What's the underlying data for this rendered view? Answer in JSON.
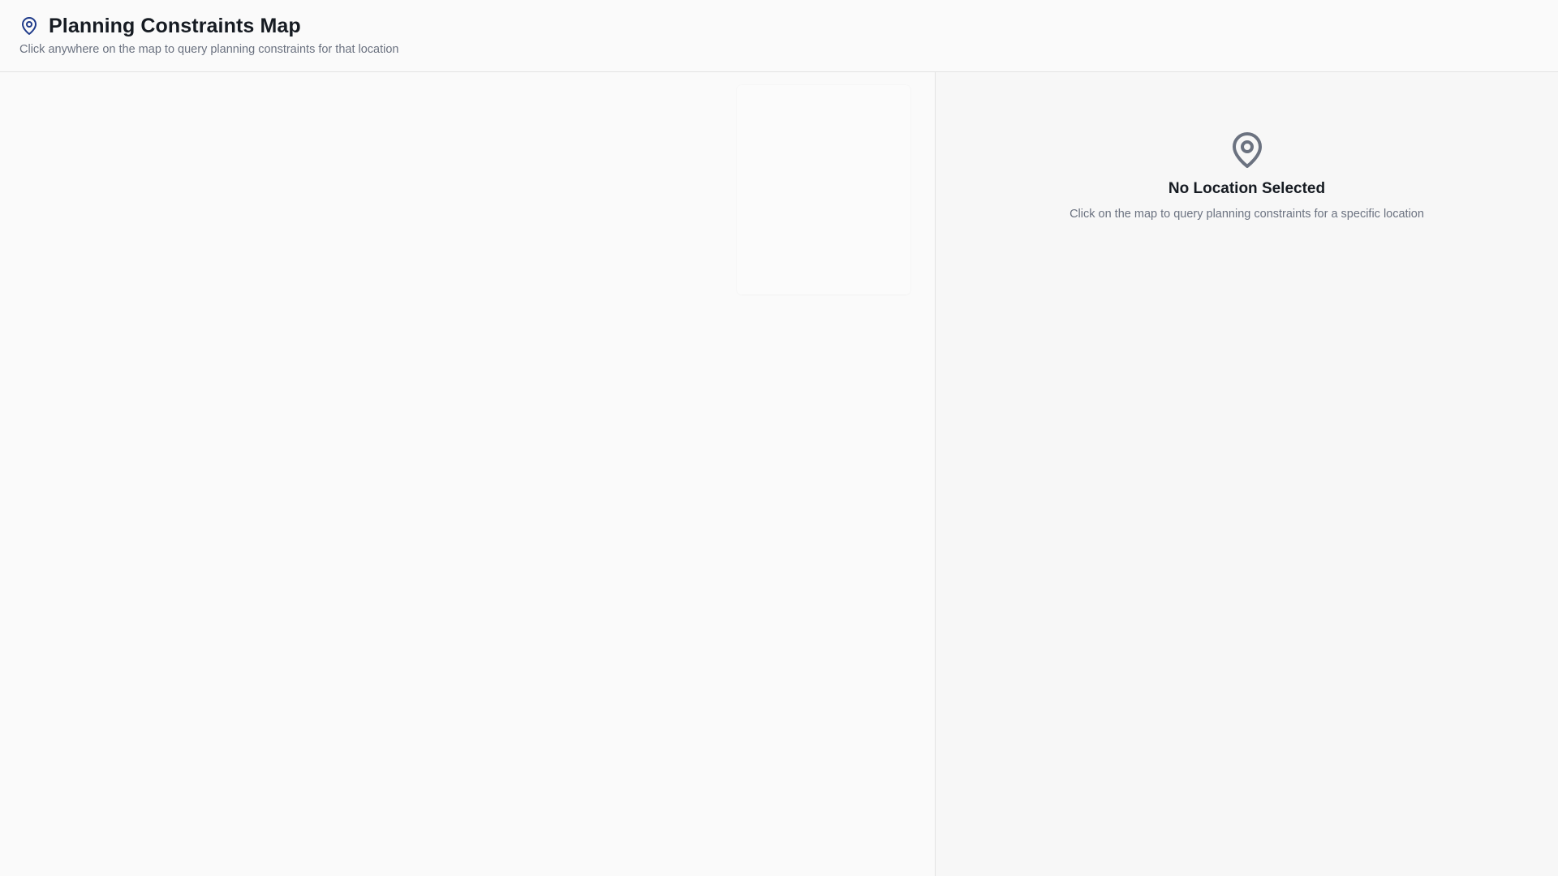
{
  "header": {
    "icon": "map-pin-icon",
    "title": "Planning Constraints Map",
    "subtitle": "Click anywhere on the map to query planning constraints for that location"
  },
  "side_panel": {
    "empty_state": {
      "icon": "map-pin-icon",
      "title": "No Location Selected",
      "text": "Click on the map to query planning constraints for a specific location"
    }
  },
  "colors": {
    "accent": "#1e3a8a",
    "title_text": "#161b22",
    "muted_text": "#6b7280",
    "empty_icon": "#6b7280",
    "border": "#e3e3e3",
    "background": "#fafafa"
  }
}
